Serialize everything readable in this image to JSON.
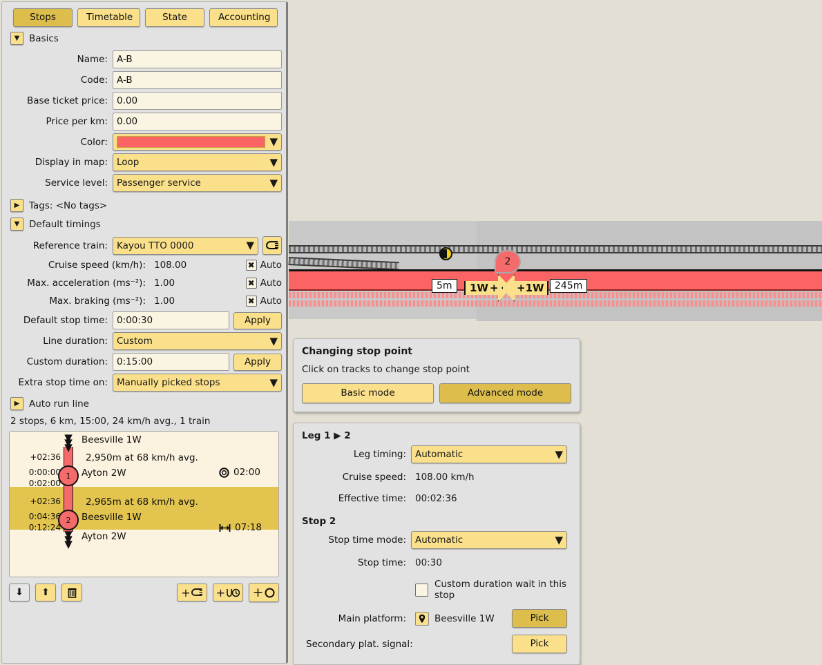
{
  "tabs": [
    {
      "label": "Stops",
      "active": true
    },
    {
      "label": "Timetable",
      "active": false
    },
    {
      "label": "State",
      "active": false
    },
    {
      "label": "Accounting",
      "active": false
    }
  ],
  "basics": {
    "section_label": "Basics",
    "expanded_glyph": "▼",
    "fields": [
      {
        "label": "Name:",
        "value": "A-B"
      },
      {
        "label": "Code:",
        "value": "A-B"
      },
      {
        "label": "Base ticket price:",
        "value": "0.00"
      },
      {
        "label": "Price per km:",
        "value": "0.00"
      }
    ],
    "color": {
      "label": "Color:",
      "value": "#fa6464"
    },
    "display_in_map": {
      "label": "Display in map:",
      "value": "Loop"
    },
    "service_level": {
      "label": "Service level:",
      "value": "Passenger service"
    }
  },
  "tags": {
    "label": "Tags: <No tags>",
    "collapsed_glyph": "▶"
  },
  "default_timings": {
    "section_label": "Default timings",
    "expanded_glyph": "▼",
    "reference_train": {
      "label": "Reference train:",
      "value": "Kayou TTO 0000",
      "icon": "train-icon"
    },
    "readouts": [
      {
        "label": "Cruise speed (km/h):",
        "value": "108.00",
        "auto_label": "Auto",
        "auto_checked": true
      },
      {
        "label": "Max. acceleration (ms⁻²):",
        "value": "1.00",
        "auto_label": "Auto",
        "auto_checked": true
      },
      {
        "label": "Max. braking (ms⁻²):",
        "value": "1.00",
        "auto_label": "Auto",
        "auto_checked": true
      }
    ],
    "default_stop_time": {
      "label": "Default stop time:",
      "value": "0:00:30",
      "apply_label": "Apply"
    },
    "line_duration": {
      "label": "Line duration:",
      "value": "Custom"
    },
    "custom_duration": {
      "label": "Custom duration:",
      "value": "0:15:00",
      "apply_label": "Apply"
    },
    "extra_stop_time": {
      "label": "Extra stop time on:",
      "value": "Manually picked stops"
    }
  },
  "auto_run_line": {
    "label": "Auto run line",
    "collapsed_glyph": "▶"
  },
  "summary": "2 stops, 6 km, 15:00, 24 km/h avg., 1 train",
  "stop_list": {
    "top_terminus": "Beesville 1W",
    "bottom_terminus": "Ayton 2W",
    "rows": [
      {
        "index": "1",
        "leg_delta": "+02:36",
        "leg_text": "2,950m at 68 km/h avg.",
        "arrive": "0:00:00",
        "depart": "0:02:00",
        "name": "Ayton 2W",
        "badge_icon": "stopwatch-icon",
        "badge_value": "02:00",
        "selected": false
      },
      {
        "index": "2",
        "leg_delta": "+02:36",
        "leg_text": "2,965m at 68 km/h avg.",
        "arrive": "0:04:36",
        "depart": "0:12:24",
        "name": "Beesville 1W",
        "badge_icon": "span-icon",
        "badge_value": "07:18",
        "selected": true
      }
    ]
  },
  "list_toolbar": {
    "move_down": "⬇",
    "move_up": "⬆",
    "delete": "🗑",
    "add_train": "+",
    "add_wait": "+",
    "add_stop": "+"
  },
  "map": {
    "labels": [
      {
        "text": "5m"
      },
      {
        "text": "245m"
      }
    ],
    "arrow_left": "1W",
    "arrow_right": "1W",
    "marker_number": "2"
  },
  "stop_point_dialog": {
    "title": "Changing stop point",
    "hint": "Click on tracks to change stop point",
    "basic_mode": "Basic mode",
    "advanced_mode": "Advanced mode",
    "advanced_active": true
  },
  "leg_panel": {
    "leg_title": "Leg 1 ▶ 2",
    "leg_timing": {
      "label": "Leg timing:",
      "value": "Automatic"
    },
    "cruise_speed": {
      "label": "Cruise speed:",
      "value": "108.00 km/h"
    },
    "effective_time": {
      "label": "Effective time:",
      "value": "00:02:36"
    },
    "stop_title": "Stop 2",
    "stop_time_mode": {
      "label": "Stop time mode:",
      "value": "Automatic"
    },
    "stop_time": {
      "label": "Stop time:",
      "value": "00:30"
    },
    "custom_duration_wait": {
      "label": "Custom duration wait in this stop",
      "checked": false
    },
    "main_platform": {
      "label": "Main platform:",
      "value": "Beesville 1W",
      "pick_label": "Pick",
      "icon": "map-pin-icon"
    },
    "secondary_signal": {
      "label": "Secondary plat. signal:",
      "value": "",
      "pick_label": "Pick"
    }
  }
}
